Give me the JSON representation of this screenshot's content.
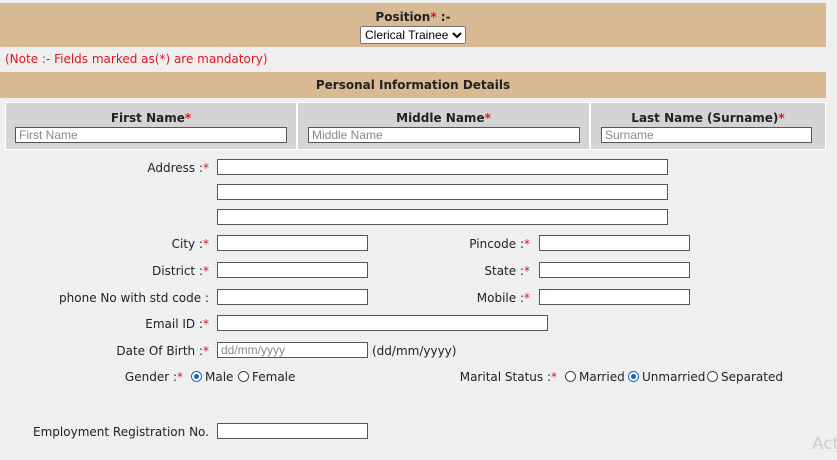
{
  "position": {
    "label": "Position",
    "required_mark": "*",
    "suffix": " :-",
    "selected": "Clerical Trainee"
  },
  "note": "(Note :- Fields marked as(*) are mandatory)",
  "section_title": "Personal Information Details",
  "name_fields": {
    "first": {
      "label": "First Name",
      "placeholder": "First Name"
    },
    "middle": {
      "label": "Middle Name",
      "placeholder": "Middle Name"
    },
    "last": {
      "label": "Last Name (Surname)",
      "placeholder": "Surname"
    }
  },
  "form": {
    "address_label": "Address :",
    "city_label": "City :",
    "district_label": "District :",
    "phone_label": "phone No with std code :",
    "email_label": "Email ID :",
    "dob_label": "Date Of Birth :",
    "dob_placeholder": "dd/mm/yyyy",
    "dob_hint": "(dd/mm/yyyy)",
    "gender_label": "Gender :",
    "gender_options": [
      "Male",
      "Female"
    ],
    "gender_selected": "Male",
    "pincode_label": "Pincode :",
    "state_label": "State :",
    "mobile_label": "Mobile :",
    "marital_label": "Marital Status :",
    "marital_options": [
      "Married",
      "Unmarried",
      "Separated"
    ],
    "marital_selected": "Unmarried",
    "employment_label": "Employment Registration No."
  },
  "watermark": "Act"
}
